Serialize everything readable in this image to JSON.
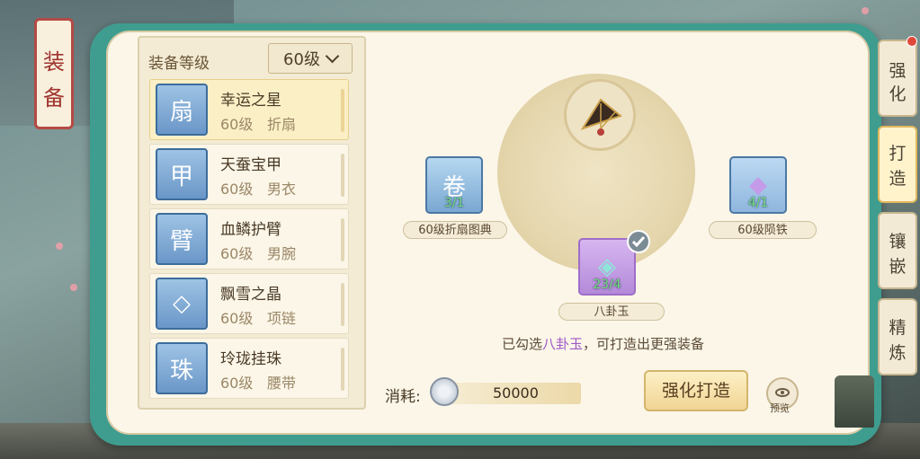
{
  "window": {
    "title_chars": [
      "装",
      "备"
    ]
  },
  "list": {
    "title": "装备等级",
    "level_select": "60级",
    "items": [
      {
        "name": "幸运之星",
        "level": "60级",
        "type": "折扇",
        "icon": "folding-fan-icon",
        "selected": true
      },
      {
        "name": "天蚕宝甲",
        "level": "60级",
        "type": "男衣",
        "icon": "armor-icon",
        "selected": false
      },
      {
        "name": "血鳞护臂",
        "level": "60级",
        "type": "男腕",
        "icon": "bracer-icon",
        "selected": false
      },
      {
        "name": "飘雪之晶",
        "level": "60级",
        "type": "项链",
        "icon": "crystal-necklace-icon",
        "selected": false
      },
      {
        "name": "玲珑挂珠",
        "level": "60级",
        "type": "腰带",
        "icon": "belt-charm-icon",
        "selected": false
      }
    ]
  },
  "forge": {
    "main_item_icon": "folding-fan-icon",
    "materials": [
      {
        "label": "60级折扇图典",
        "count": "3/1",
        "icon": "scroll-icon"
      },
      {
        "label": "60级陨铁",
        "count": "4/1",
        "icon": "purple-ore-icon"
      },
      {
        "label": "八卦玉",
        "count": "23/4",
        "icon": "bagua-jade-icon",
        "checked": true
      }
    ],
    "hint_prefix": "已勾选",
    "hint_highlight": "八卦玉",
    "hint_suffix": "，可打造出更强装备",
    "cost_label": "消耗:",
    "cost_value": "50000",
    "forge_button": "强化打造",
    "preview_label": "预览"
  },
  "tabs": [
    {
      "label": [
        "强",
        "化"
      ],
      "active": false
    },
    {
      "label": [
        "打",
        "造"
      ],
      "active": true
    },
    {
      "label": [
        "镶",
        "嵌"
      ],
      "active": false
    },
    {
      "label": [
        "精",
        "炼"
      ],
      "active": false
    }
  ],
  "colors": {
    "frame": "#3f9d8f",
    "panel": "#fbf6e8",
    "highlight": "#a057c9",
    "count": "#6fe07d"
  }
}
